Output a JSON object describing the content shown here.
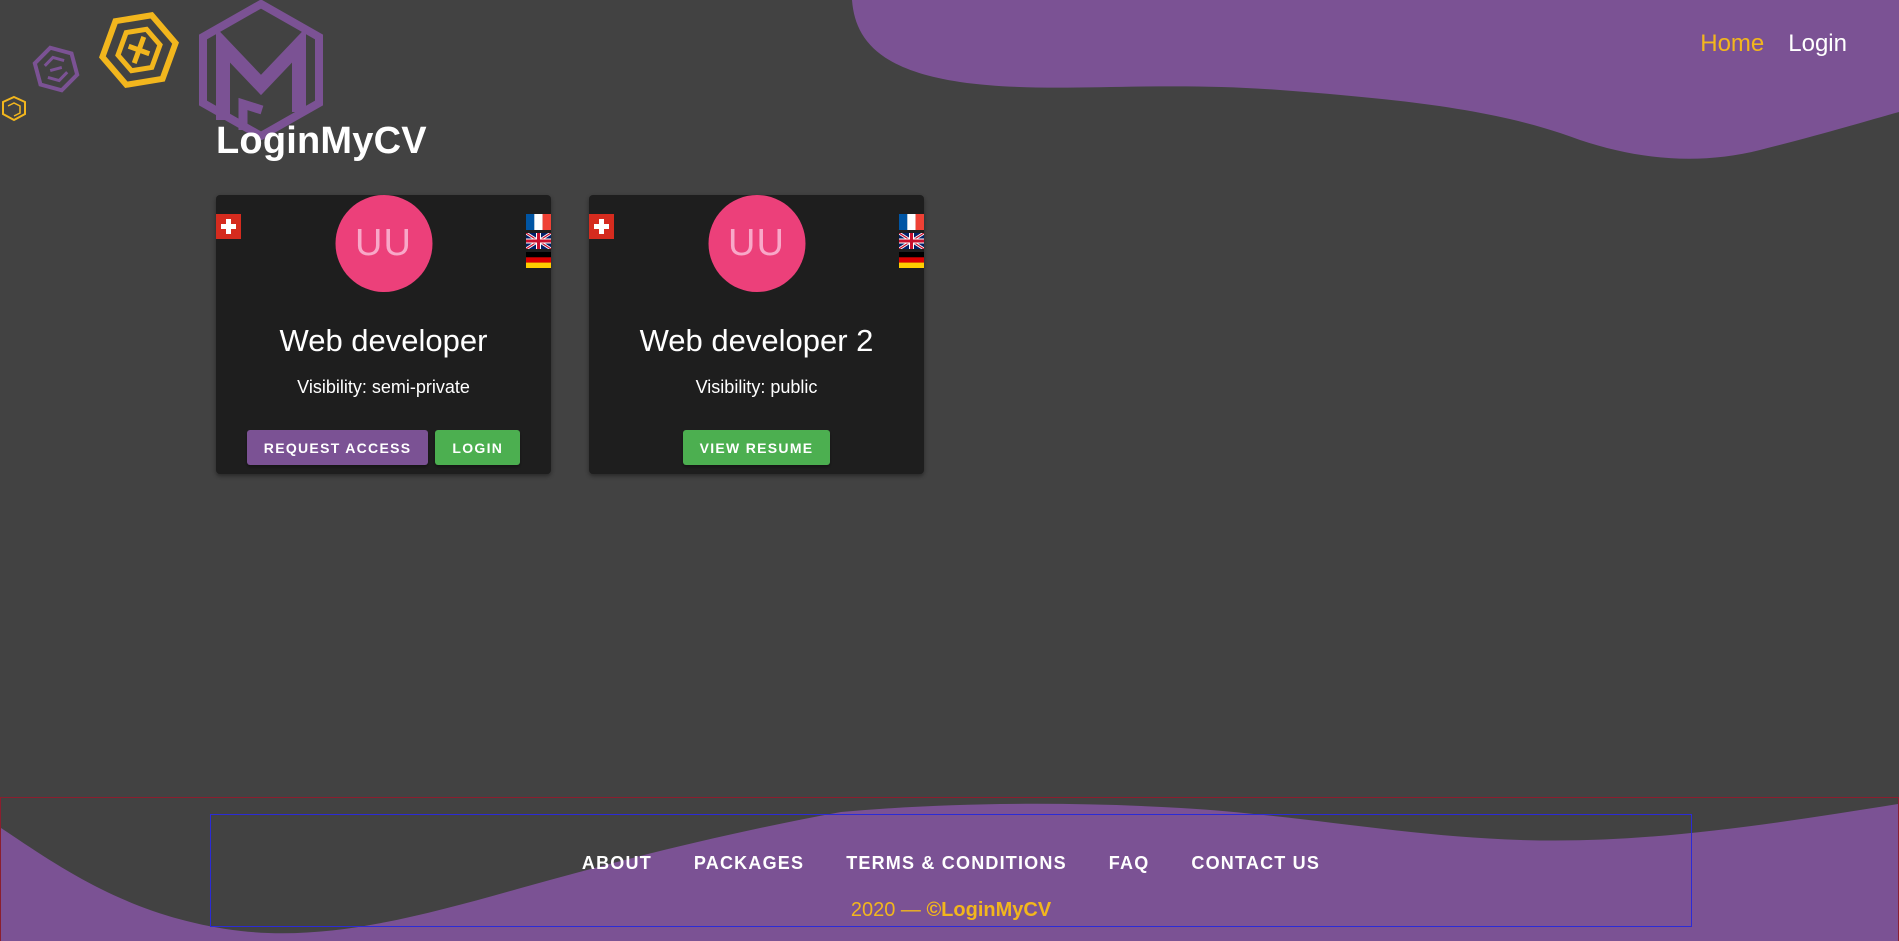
{
  "colors": {
    "background": "#424242",
    "accent_purple": "#7b5294",
    "accent_yellow": "#f2b61d",
    "card_bg": "#1e1e1e",
    "avatar_pink": "#ec407a",
    "button_green": "#4caf50"
  },
  "nav": {
    "home": "Home",
    "login": "Login"
  },
  "site_title": "LoginMyCV",
  "cards": [
    {
      "avatar_initials": "UU",
      "title": "Web developer",
      "visibility": "Visibility: semi-private",
      "flags": [
        "swiss-flag-icon",
        "french-flag-icon",
        "uk-flag-icon",
        "german-flag-icon"
      ],
      "buttons": [
        "REQUEST ACCESS",
        "LOGIN"
      ]
    },
    {
      "avatar_initials": "UU",
      "title": "Web developer 2",
      "visibility": "Visibility: public",
      "flags": [
        "swiss-flag-icon",
        "french-flag-icon",
        "uk-flag-icon",
        "german-flag-icon"
      ],
      "buttons": [
        "VIEW RESUME"
      ]
    }
  ],
  "footer": {
    "links": [
      "ABOUT",
      "PACKAGES",
      "TERMS & CONDITIONS",
      "FAQ",
      "CONTACT US"
    ],
    "year": "2020 — ",
    "copyright": "©LoginMyCV"
  },
  "icons": [
    "logo-small-yellow-icon",
    "logo-small-purple-icon",
    "logo-yellow-icon",
    "logo-large-purple-icon"
  ]
}
